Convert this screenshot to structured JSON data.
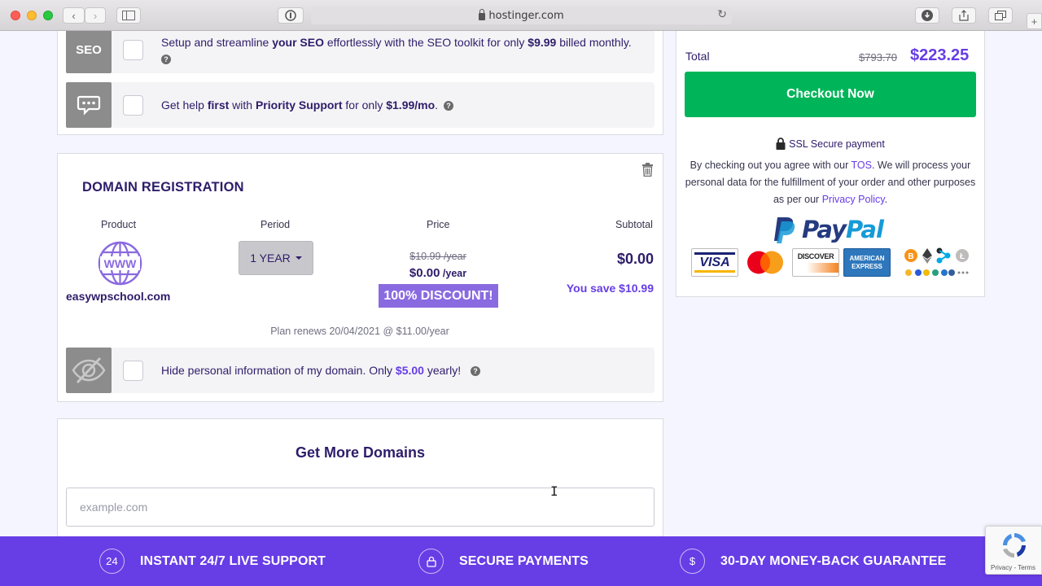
{
  "browser": {
    "url": "hostinger.com"
  },
  "addons": {
    "seo": {
      "icon_label": "SEO",
      "text_pre": "Setup and streamline ",
      "text_bold": "your SEO",
      "text_mid": " effortlessly with the SEO toolkit for only ",
      "price": "$9.99",
      "text_post": " billed monthly."
    },
    "priority": {
      "text_pre": "Get help ",
      "text_bold1": "first",
      "text_mid": " with ",
      "text_bold2": "Priority Support",
      "text_mid2": " for only ",
      "price": "$1.99/mo",
      "text_post": "."
    }
  },
  "domain": {
    "title": "DOMAIN REGISTRATION",
    "columns": [
      "Product",
      "Period",
      "Price",
      "Subtotal"
    ],
    "name": "easywpschool.com",
    "period": "1 YEAR",
    "price_old": "$10.99 /year",
    "price_new": "$0.00",
    "price_new_unit": " /year",
    "discount": "100% DISCOUNT!",
    "subtotal": "$0.00",
    "save": "You save $10.99",
    "renews": "Plan renews 20/04/2021 @ $11.00/year",
    "privacy_pre": "Hide personal information of my domain. Only ",
    "privacy_price": "$5.00",
    "privacy_post": " yearly!"
  },
  "more_domains": {
    "title": "Get More Domains",
    "placeholder": "example.com"
  },
  "summary": {
    "total_label": "Total",
    "total_old": "$793.70",
    "total_new": "$223.25",
    "checkout": "Checkout Now",
    "ssl": "SSL Secure payment",
    "tos_1": "By checking out you agree with our ",
    "tos_link": "TOS",
    "tos_2": ". We will process your personal data for the fulfillment of your order and other purposes as per our ",
    "privacy_link": "Privacy Policy",
    "tos_3": ".",
    "paypal_1": "Pay",
    "paypal_2": "Pal",
    "cards": [
      "VISA",
      "DISCOVER",
      "AMERICAN EXPRESS"
    ]
  },
  "footer": {
    "support": "INSTANT 24/7 LIVE SUPPORT",
    "support_icon": "24",
    "payments": "SECURE PAYMENTS",
    "guarantee": "30-DAY MONEY-BACK GUARANTEE",
    "guarantee_icon": "$"
  },
  "recaptcha": {
    "text": "Privacy - Terms"
  },
  "colors": {
    "accent": "#673de6",
    "checkout": "#00b559",
    "text": "#2f1c6a"
  }
}
